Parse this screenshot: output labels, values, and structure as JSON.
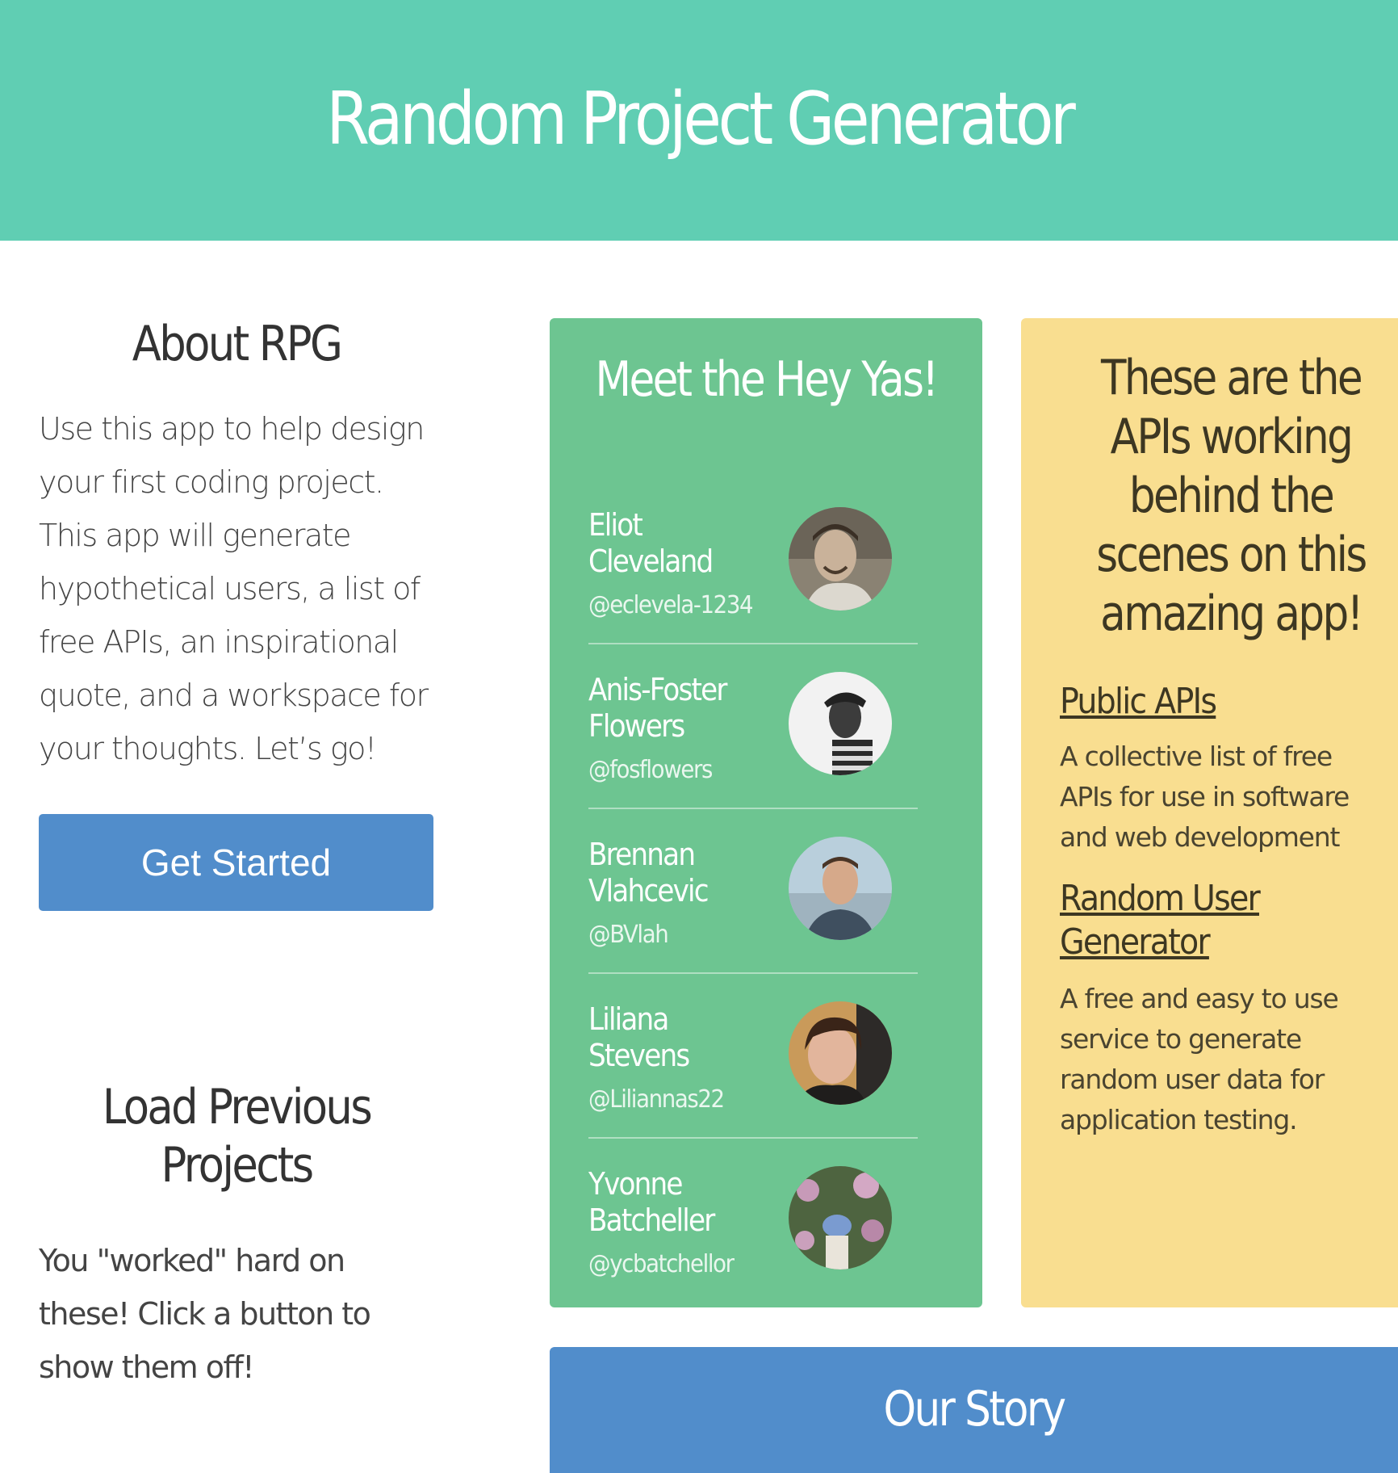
{
  "header": {
    "title": "Random Project Generator"
  },
  "about": {
    "title": "About RPG",
    "text": "Use this app to help design your first coding project. This app will generate hypothetical users, a list of free APIs, an inspirational quote, and a workspace for your thoughts. Let’s go!",
    "button_label": "Get Started"
  },
  "load": {
    "title": "Load Previous Projects",
    "text": "You \"worked\" hard on these! Click a button to show them off!"
  },
  "team": {
    "title": "Meet the Hey Yas!",
    "members": [
      {
        "name": "Eliot Cleveland",
        "handle": "@eclevela-1234",
        "avatar_color": "#5b5349"
      },
      {
        "name": "Anis-Foster Flowers",
        "handle": "@fosflowers",
        "avatar_color": "#9a9a9a"
      },
      {
        "name": "Brennan Vlahcevic",
        "handle": "@BVlah",
        "avatar_color": "#8fa8b8"
      },
      {
        "name": "Liliana Stevens",
        "handle": "@Liliannas22",
        "avatar_color": "#7a5a38"
      },
      {
        "name": "Yvonne Batcheller",
        "handle": "@ycbatchellor",
        "avatar_color": "#6f7f5a"
      }
    ]
  },
  "apis": {
    "title": "These are the APIs working behind the scenes on this amazing app!",
    "items": [
      {
        "name": "Public APIs",
        "description": "A collective list of free APIs for use in software and web development"
      },
      {
        "name": "Random User Generator",
        "description": "A free and easy to use service to generate random user data for application testing."
      }
    ]
  },
  "story": {
    "title": "Our Story"
  },
  "colors": {
    "header_bg": "#60ceb3",
    "team_bg": "#6dc591",
    "api_bg": "#f9de90",
    "button_bg": "#518dcb"
  }
}
